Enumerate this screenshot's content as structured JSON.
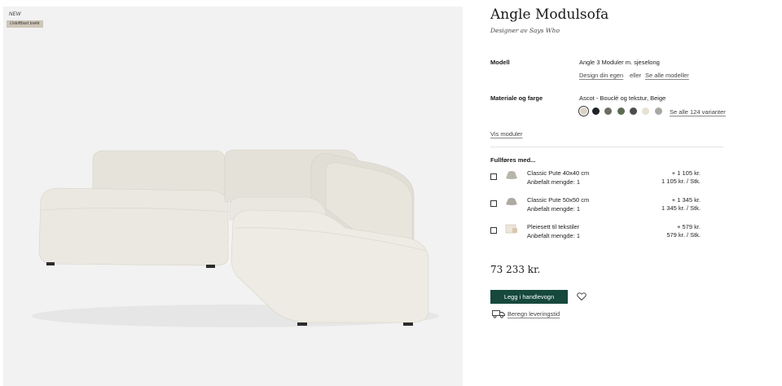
{
  "gallery": {
    "badge_new": "NEW",
    "badge_fabric": "Uskiftbart trekk"
  },
  "product": {
    "title": "Angle Modulsofa",
    "subtitle": "Designer av Says Who"
  },
  "model": {
    "label": "Modell",
    "value": "Angle 3 Moduler m. sjeselong",
    "design_link": "Design din egen",
    "or_text": "eller",
    "all_models_link": "Se alle modeller"
  },
  "material": {
    "label": "Materiale og farge",
    "value": "Ascot - Bouclé og tekstur, Beige",
    "swatches": [
      {
        "color": "#d8d3c4",
        "selected": true
      },
      {
        "color": "#1f2326",
        "selected": false
      },
      {
        "color": "#6c6c62",
        "selected": false
      },
      {
        "color": "#5d6b52",
        "selected": false
      },
      {
        "color": "#4c4c4c",
        "selected": false
      },
      {
        "color": "#e7e2d1",
        "selected": false
      },
      {
        "color": "#a9a8a3",
        "selected": false
      }
    ],
    "variants_link": "Se alle 124 varianter"
  },
  "modules_link": "Vis moduler",
  "addons": {
    "heading": "Fullføres med...",
    "items": [
      {
        "name": "Classic Pute 40x40 cm",
        "qty": "Anbefalt mengde: 1",
        "price": "+ 1 105 kr.",
        "unit": "1 105 kr. / Stk.",
        "icon": "cushion-icon"
      },
      {
        "name": "Classic Pute 50x50 cm",
        "qty": "Anbefalt mengde: 1",
        "price": "+ 1 345 kr.",
        "unit": "1 345 kr. / Stk.",
        "icon": "cushion-icon"
      },
      {
        "name": "Pleiesett til tekstiler",
        "qty": "Anbefalt mengde: 1",
        "price": "+ 579 kr.",
        "unit": "579 kr. / Stk.",
        "icon": "care-kit-icon"
      }
    ]
  },
  "price": "73 233 kr.",
  "cart_button": "Legg i handlevogn",
  "delivery_link": "Beregn leveringstid",
  "colors": {
    "accent": "#16483c",
    "sofa": "#ebe8e1",
    "image_bg": "#f2f2f2"
  }
}
